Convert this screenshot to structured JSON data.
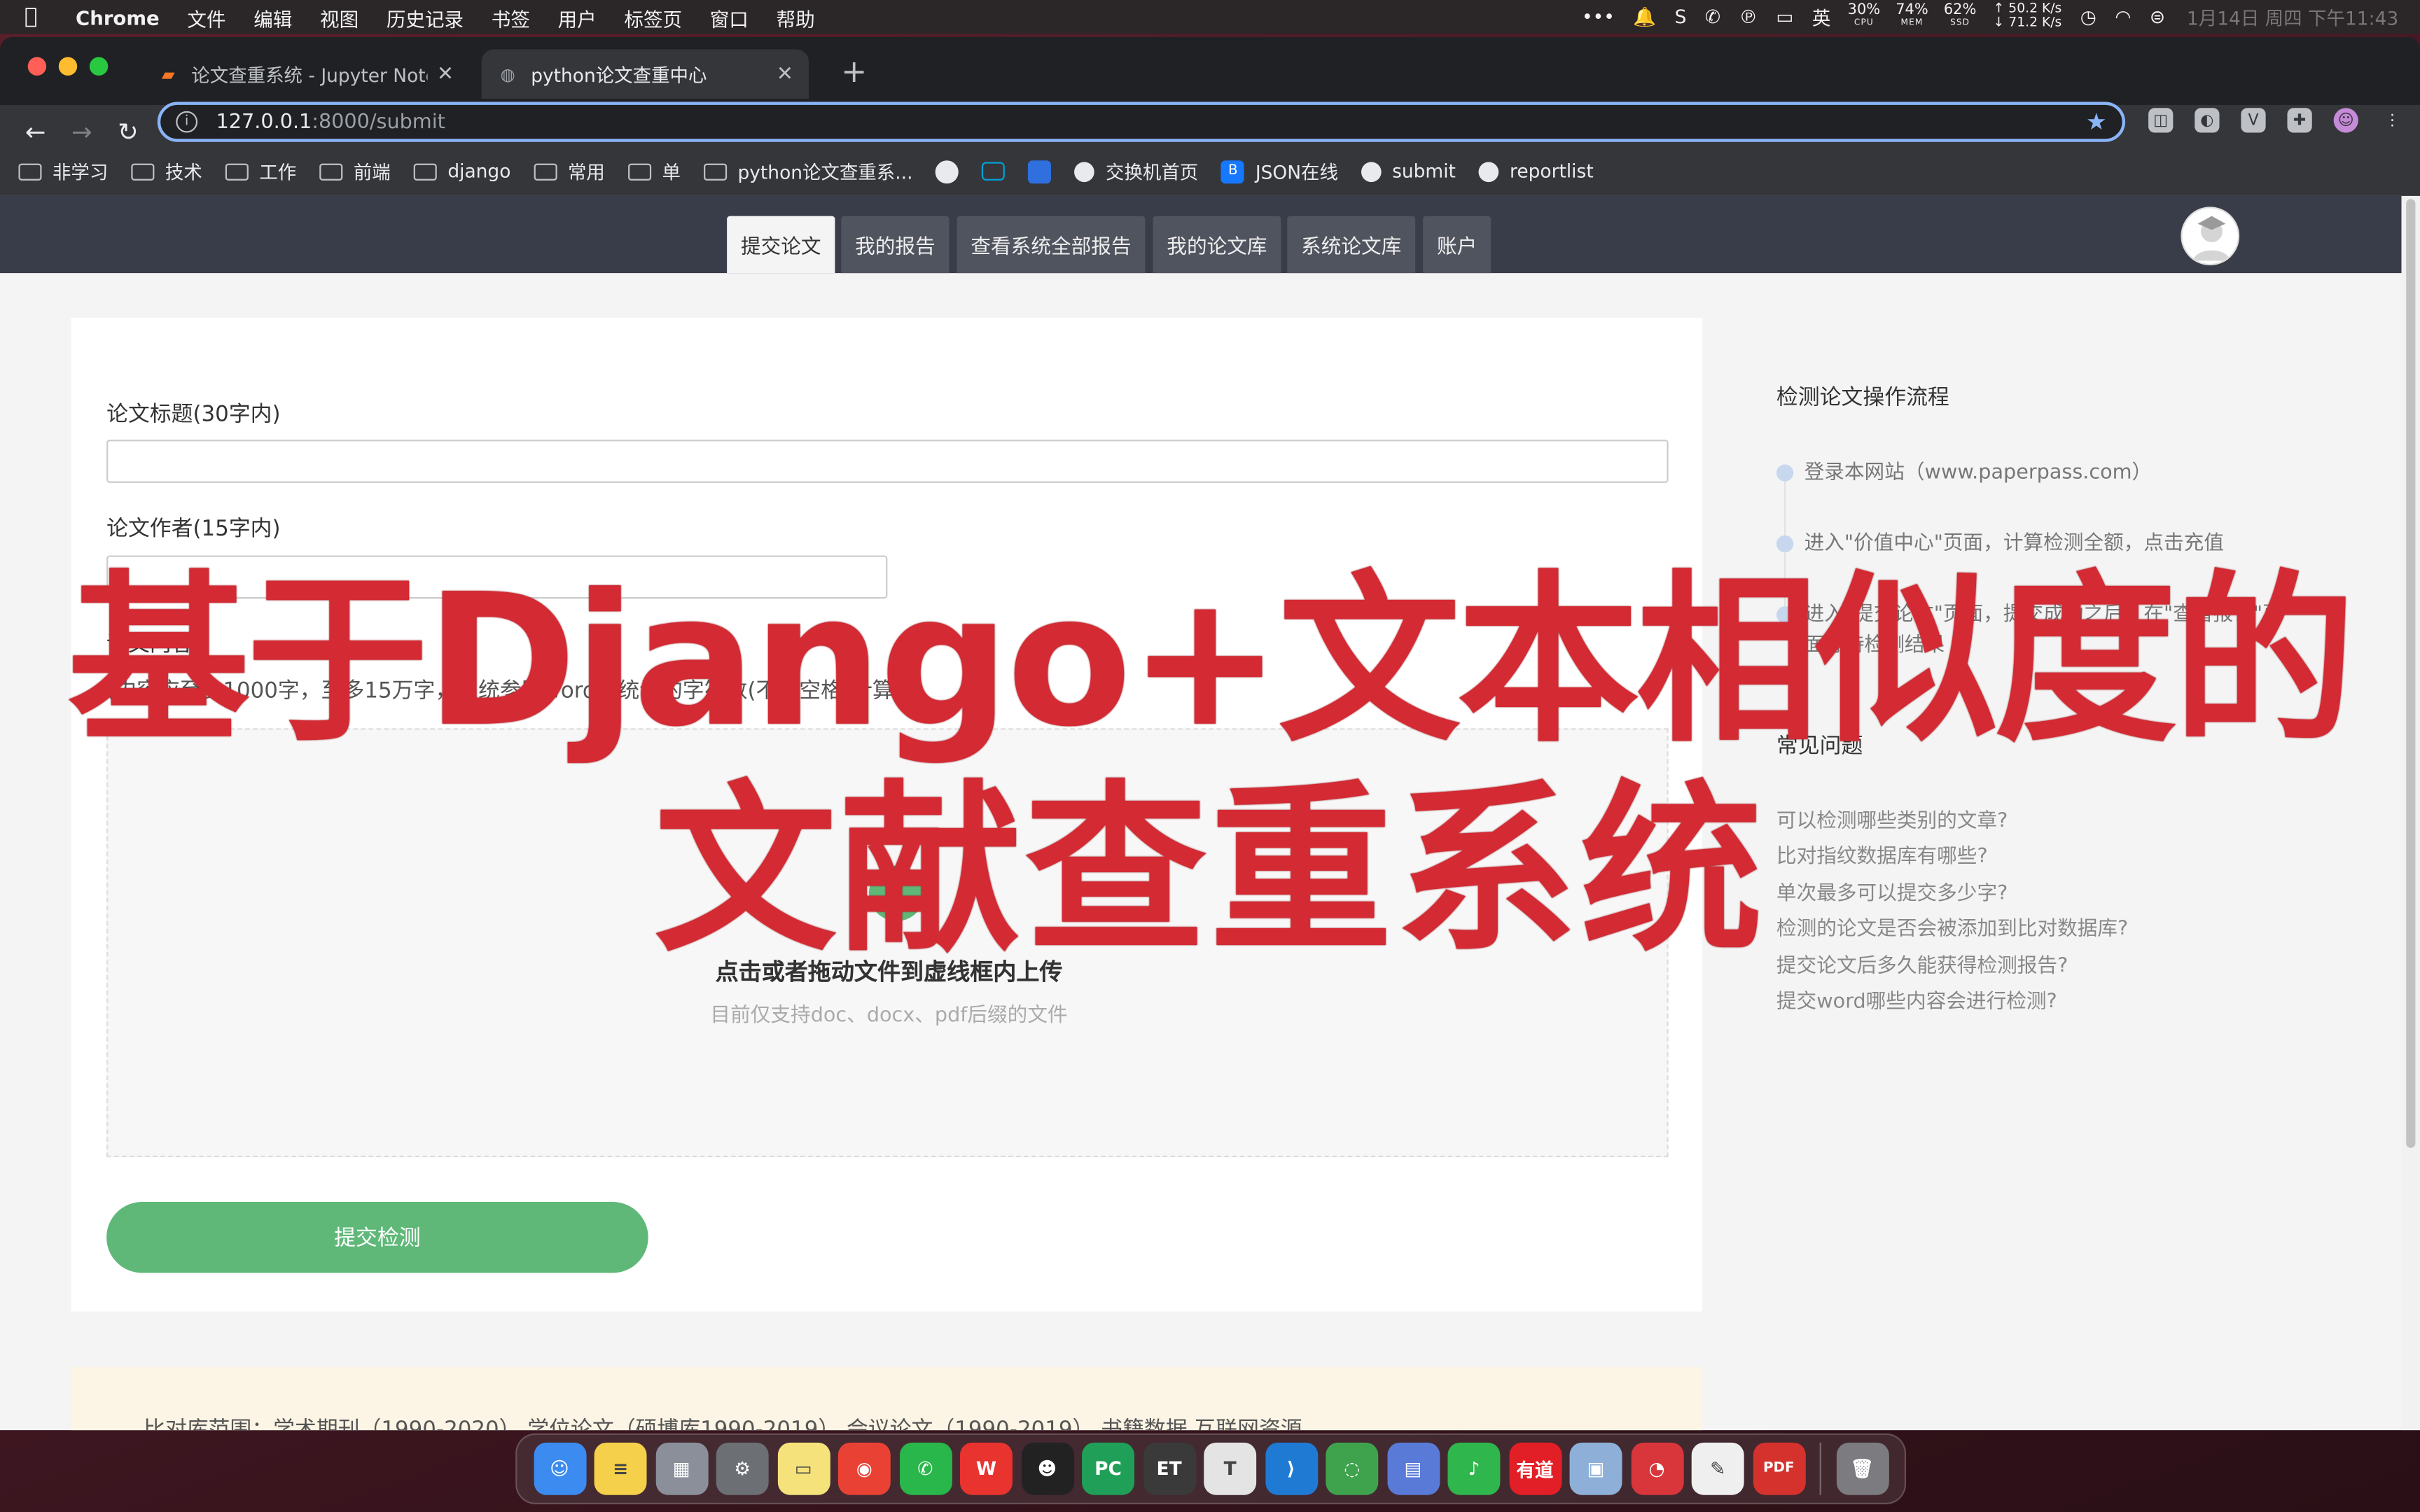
{
  "menubar": {
    "app": "Chrome",
    "items": [
      "文件",
      "编辑",
      "视图",
      "历史记录",
      "书签",
      "用户",
      "标签页",
      "窗口",
      "帮助"
    ],
    "ime": "英",
    "stats": [
      {
        "value": "30%",
        "key": "CPU"
      },
      {
        "value": "74%",
        "key": "MEM"
      },
      {
        "value": "62%",
        "key": "SSD"
      }
    ],
    "net_up": "↑ 50.2 K/s",
    "net_down": "↓ 71.2 K/s",
    "clock": "1月14日 周四 下午11:43"
  },
  "tabs": [
    {
      "title": "论文查重系统 - Jupyter Notebook",
      "active": false
    },
    {
      "title": "python论文查重中心",
      "active": true
    }
  ],
  "omnibox": {
    "host": "127.0.0.1",
    "path": ":8000/submit"
  },
  "bookmarks": [
    {
      "label": "非学习",
      "icon": "folder"
    },
    {
      "label": "技术",
      "icon": "folder"
    },
    {
      "label": "工作",
      "icon": "folder"
    },
    {
      "label": "前端",
      "icon": "folder"
    },
    {
      "label": "django",
      "icon": "folder"
    },
    {
      "label": "常用",
      "icon": "folder"
    },
    {
      "label": "单",
      "icon": "folder"
    },
    {
      "label": "python论文查重系...",
      "icon": "folder"
    },
    {
      "label": "",
      "icon": "github"
    },
    {
      "label": "",
      "icon": "bilibili"
    },
    {
      "label": "",
      "icon": "baidu"
    },
    {
      "label": "交换机首页",
      "icon": "globe"
    },
    {
      "label": "JSON在线",
      "icon": "json"
    },
    {
      "label": "submit",
      "icon": "globe"
    },
    {
      "label": "reportlist",
      "icon": "globe"
    }
  ],
  "sitenav": {
    "tabs": [
      "提交论文",
      "我的报告",
      "查看系统全部报告",
      "我的论文库",
      "系统论文库",
      "账户"
    ],
    "active": 0
  },
  "form": {
    "title_label": "论文标题(30字内)",
    "author_label": "论文作者(15字内)",
    "content_label": "论文内容",
    "content_hint": "(内容应至少1000字，至多15万字，系统参照word等统计的字符数(不含空格)计算)",
    "upload_main": "点击或者拖动文件到虚线框内上传",
    "upload_sub": "目前仅支持doc、docx、pdf后缀的文件",
    "submit_label": "提交检测"
  },
  "sidebar": {
    "flow_title": "检测论文操作流程",
    "steps": [
      "登录本网站（www.paperpass.com）",
      "进入\"价值中心\"页面，计算检测全额，点击充值",
      "进入\"提交论文\"页面，提交成功之后，在\"查看报告\"页面等待检测结果"
    ],
    "faq_title": "常见问题",
    "faq": [
      "可以检测哪些类别的文章?",
      "比对指纹数据库有哪些?",
      "单次最多可以提交多少字?",
      "检测的论文是否会被添加到比对数据库?",
      "提交论文后多久能获得检测报告?",
      "提交word哪些内容会进行检测?"
    ]
  },
  "range": {
    "text": "比对库范围：学术期刊（1990-2020）   学位论文（硕博库1990-2019）   会议论文（1990-2019）   书籍数据   互联网资源"
  },
  "overlay": {
    "line1": "基于Django+文本相似度的",
    "line2": "文献查重系统"
  },
  "dock": [
    {
      "name": "finder",
      "color": "#3b8bf0",
      "glyph": "☺"
    },
    {
      "name": "notes",
      "color": "#f5d04a",
      "glyph": "≡"
    },
    {
      "name": "launchpad",
      "color": "#8a8f99",
      "glyph": "▦"
    },
    {
      "name": "system-preferences",
      "color": "#6c6f74",
      "glyph": "⚙"
    },
    {
      "name": "stickies",
      "color": "#f6e27a",
      "glyph": "▭"
    },
    {
      "name": "chrome",
      "color": "#e94235",
      "glyph": "◉"
    },
    {
      "name": "wechat",
      "color": "#29b64a",
      "glyph": "✆"
    },
    {
      "name": "wps",
      "color": "#e8332e",
      "glyph": "W"
    },
    {
      "name": "qq",
      "color": "#222222",
      "glyph": "☻"
    },
    {
      "name": "pycharm",
      "color": "#1f9f57",
      "glyph": "PC"
    },
    {
      "name": "typora",
      "color": "#3a3a3a",
      "glyph": "ET"
    },
    {
      "name": "text-editor",
      "color": "#e4e4e4",
      "glyph": "T"
    },
    {
      "name": "vscode",
      "color": "#1f7ad4",
      "glyph": "⟩"
    },
    {
      "name": "anaconda",
      "color": "#3fa34d",
      "glyph": "◌"
    },
    {
      "name": "archive",
      "color": "#5a7ad8",
      "glyph": "▤"
    },
    {
      "name": "music",
      "color": "#2fb64c",
      "glyph": "♪"
    },
    {
      "name": "youdao",
      "color": "#e21f26",
      "glyph": "有道"
    },
    {
      "name": "preview",
      "color": "#8eb0d8",
      "glyph": "▣"
    },
    {
      "name": "netease",
      "color": "#d8363b",
      "glyph": "◔"
    },
    {
      "name": "textedit",
      "color": "#efefef",
      "glyph": "✎"
    },
    {
      "name": "pdf",
      "color": "#d6322d",
      "glyph": "PDF"
    },
    {
      "name": "trash",
      "color": "#7b7b80",
      "glyph": "🗑"
    }
  ]
}
